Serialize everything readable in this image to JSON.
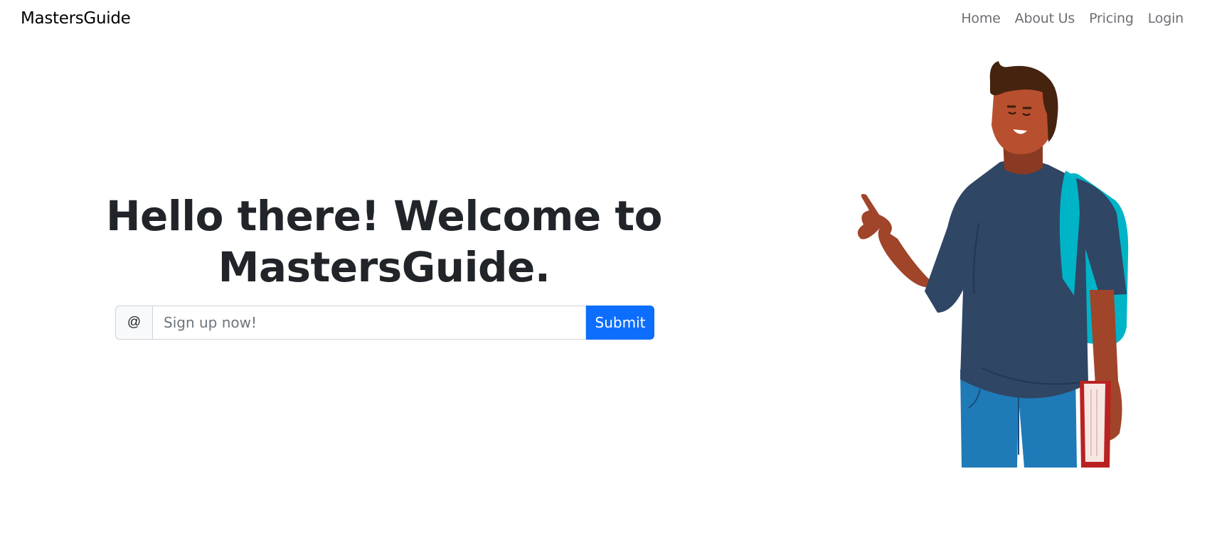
{
  "nav": {
    "brand": "MastersGuide",
    "links": [
      "Home",
      "About Us",
      "Pricing",
      "Login"
    ]
  },
  "hero": {
    "title_line1": "Hello there! Welcome to",
    "title_line2": "MastersGuide."
  },
  "signup": {
    "addon": "@",
    "placeholder": "Sign up now!",
    "submit_label": "Submit"
  },
  "colors": {
    "primary": "#0d6efd",
    "shirt": "#2f4664",
    "backpack": "#00b4c8",
    "jeans": "#1f7ab8",
    "skin": "#a0452a",
    "hair": "#45230f",
    "book": "#b92221"
  }
}
